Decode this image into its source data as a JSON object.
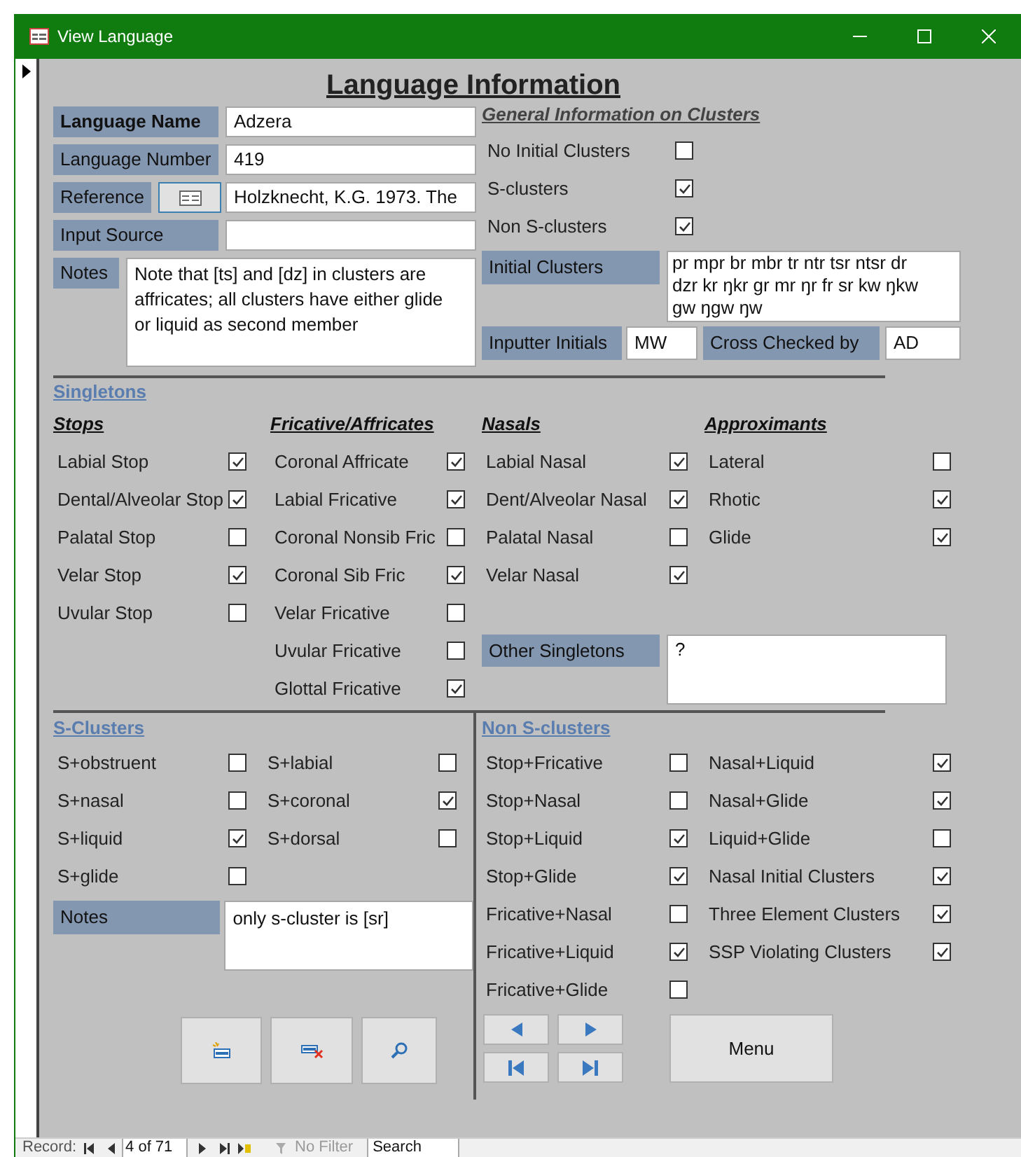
{
  "window": {
    "title": "View Language"
  },
  "heading": "Language Information",
  "fields": [
    {
      "kind": "text",
      "label": "Language Name",
      "value": "Adzera",
      "bold": true
    },
    {
      "kind": "text",
      "label": "Language Number",
      "value": "419",
      "bold": false
    },
    {
      "kind": "reference",
      "label": "Reference",
      "value": "Holzknecht, K.G. 1973. The",
      "bold": false
    },
    {
      "kind": "text",
      "label": "Input Source",
      "bold": false
    }
  ],
  "notes": {
    "label": "Notes",
    "value": "Note that [ts] and [dz] in clusters are affricates; all clusters have either glide or liquid as second  member"
  },
  "general": {
    "heading": "General Information on Clusters",
    "checks": [
      {
        "label": "No Initial Clusters",
        "checked": false
      },
      {
        "label": "S-clusters",
        "checked": true
      },
      {
        "label": "Non S-clusters",
        "checked": true
      }
    ],
    "initial_clusters": {
      "label": "Initial Clusters",
      "value": "pr mpr br mbr tr ntr tsr ntsr dr dzr kr ŋkr gr mr ŋr fr sr kw ŋkw gw ŋgw ŋw"
    },
    "inputter": {
      "label": "Inputter Initials",
      "value": "MW"
    },
    "cross_checked": {
      "label": "Cross Checked by",
      "value": "AD"
    }
  },
  "singletons": {
    "heading": "Singletons",
    "columns": [
      {
        "heading": "Stops",
        "items": [
          {
            "label": "Labial Stop",
            "checked": true
          },
          {
            "label": "Dental/Alveolar Stop",
            "checked": true
          },
          {
            "label": "Palatal Stop",
            "checked": false
          },
          {
            "label": "Velar Stop",
            "checked": true
          },
          {
            "label": "Uvular Stop",
            "checked": false
          }
        ]
      },
      {
        "heading": "Fricative/Affricates",
        "items": [
          {
            "label": "Coronal Affricate",
            "checked": true
          },
          {
            "label": "Labial Fricative",
            "checked": true
          },
          {
            "label": "Coronal Nonsib Fric",
            "checked": false
          },
          {
            "label": "Coronal Sib Fric",
            "checked": true
          },
          {
            "label": "Velar Fricative",
            "checked": false
          },
          {
            "label": "Uvular Fricative",
            "checked": false
          },
          {
            "label": "Glottal Fricative",
            "checked": true
          }
        ]
      },
      {
        "heading": "Nasals",
        "items": [
          {
            "label": "Labial Nasal",
            "checked": true
          },
          {
            "label": "Dent/Alveolar Nasal",
            "checked": true
          },
          {
            "label": "Palatal Nasal",
            "checked": false
          },
          {
            "label": "Velar Nasal",
            "checked": true
          }
        ]
      },
      {
        "heading": "Approximants",
        "items": [
          {
            "label": "Lateral",
            "checked": false
          },
          {
            "label": "Rhotic",
            "checked": true
          },
          {
            "label": "Glide",
            "checked": true
          }
        ]
      }
    ],
    "other": {
      "label": "Other Singletons",
      "value": "?"
    }
  },
  "s_clusters": {
    "heading": "S-Clusters",
    "columns": [
      [
        {
          "label": "S+obstruent",
          "checked": false
        },
        {
          "label": "S+nasal",
          "checked": false
        },
        {
          "label": "S+liquid",
          "checked": true
        },
        {
          "label": "S+glide",
          "checked": false
        }
      ],
      [
        {
          "label": "S+labial",
          "checked": false
        },
        {
          "label": "S+coronal",
          "checked": true
        },
        {
          "label": "S+dorsal",
          "checked": false
        }
      ]
    ],
    "notes": {
      "label": "Notes",
      "value": "only s-cluster is [sr]"
    }
  },
  "non_s_clusters": {
    "heading": "Non S-clusters",
    "columns": [
      [
        {
          "label": "Stop+Fricative",
          "checked": false
        },
        {
          "label": "Stop+Nasal",
          "checked": false
        },
        {
          "label": "Stop+Liquid",
          "checked": true
        },
        {
          "label": "Stop+Glide",
          "checked": true
        },
        {
          "label": "Fricative+Nasal",
          "checked": false
        },
        {
          "label": "Fricative+Liquid",
          "checked": true
        },
        {
          "label": "Fricative+Glide",
          "checked": false
        }
      ],
      [
        {
          "label": "Nasal+Liquid",
          "checked": true
        },
        {
          "label": "Nasal+Glide",
          "checked": true
        },
        {
          "label": "Liquid+Glide",
          "checked": false
        },
        {
          "label": "Nasal Initial Clusters",
          "checked": true
        },
        {
          "label": "Three Element Clusters",
          "checked": true
        },
        {
          "label": "SSP Violating Clusters",
          "checked": true
        }
      ]
    ]
  },
  "menu_button": "Menu",
  "record_bar": {
    "label": "Record:",
    "position": "4 of 71",
    "filter": "No Filter",
    "search": "Search"
  }
}
